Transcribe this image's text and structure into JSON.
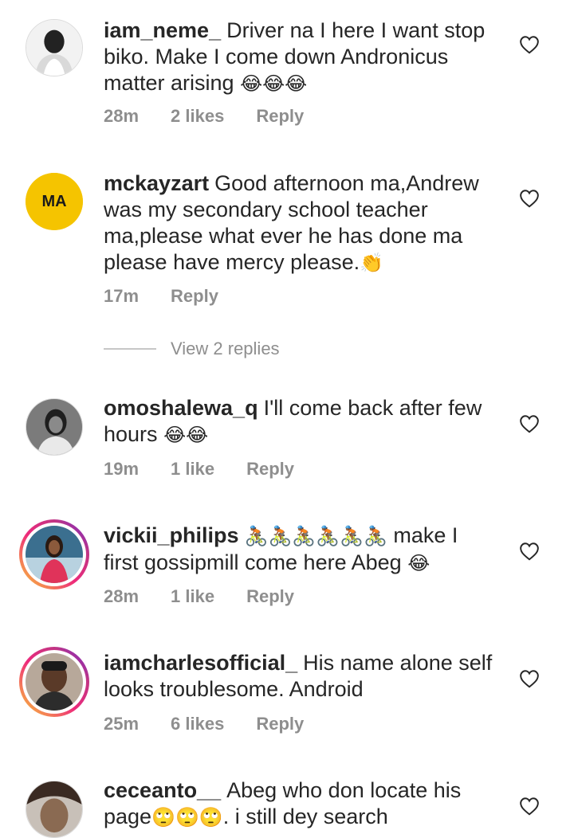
{
  "comments": [
    {
      "username": "iam_neme_",
      "text": "Driver na I here I want stop biko. Make I come down Andronicus matter arising",
      "emoji": "😂😂😂",
      "time": "28m",
      "likes": "2 likes",
      "reply": "Reply"
    },
    {
      "username": "mckayzart",
      "text": "Good afternoon ma,Andrew was my secondary school teacher ma,please what ever he has done ma please have mercy please.",
      "emoji": "👏",
      "time": "17m",
      "likes": "",
      "reply": "Reply",
      "avatar_text": "MA"
    },
    {
      "username": "omoshalewa_q",
      "text": "I'll come back after few hours",
      "emoji": "😂😂",
      "time": "19m",
      "likes": "1 like",
      "reply": "Reply"
    },
    {
      "username": "vickii_philips",
      "text_pre": "🚴🏾🚴🏾🚴🏾🚴🏾🚴🏾🚴🏾",
      "text": "make I first gossipmill come here Abeg",
      "emoji": "😂",
      "time": "28m",
      "likes": "1 like",
      "reply": "Reply"
    },
    {
      "username": "iamcharlesofficial_",
      "text": "His name alone self looks troublesome. Android",
      "emoji": "",
      "time": "25m",
      "likes": "6 likes",
      "reply": "Reply"
    },
    {
      "username": "ceceanto__",
      "text": "Abeg who don locate his page",
      "emoji": "🙄🙄🙄",
      "text_post": ". i still dey search",
      "time": "",
      "likes": "",
      "reply": ""
    }
  ],
  "view_replies": "View 2 replies",
  "icons": {
    "heart": "heart-outline-icon"
  },
  "colors": {
    "text": "#262626",
    "meta": "#8e8e8e",
    "story_ring_start": "#f9ce34",
    "story_ring_end": "#6228d7",
    "mckayzart_avatar": "#f5c400"
  }
}
